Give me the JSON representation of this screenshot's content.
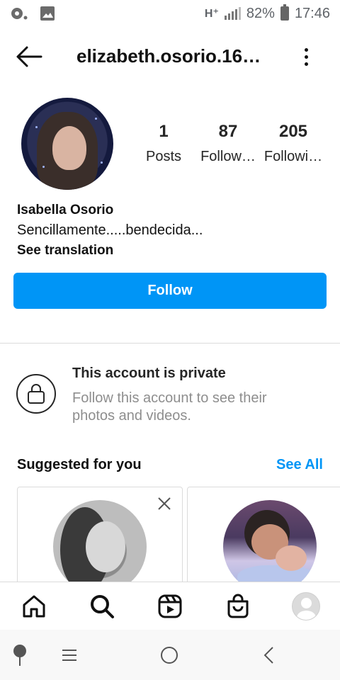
{
  "status_bar": {
    "network": "H⁺",
    "battery": "82%",
    "time": "17:46",
    "icons": [
      "media-dot-icon",
      "image-icon",
      "signal-icon",
      "battery-icon"
    ]
  },
  "header": {
    "username": "elizabeth.osorio.16…",
    "back_icon": "arrow-left-icon",
    "more_icon": "vertical-dots-icon"
  },
  "profile": {
    "stats": [
      {
        "value": "1",
        "label": "Posts"
      },
      {
        "value": "87",
        "label": "Follow…"
      },
      {
        "value": "205",
        "label": "Followi…"
      }
    ],
    "full_name": "Isabella Osorio",
    "bio": "Sencillamente.....bendecida...",
    "see_translation": "See translation",
    "follow_button": "Follow"
  },
  "private_notice": {
    "title": "This account is private",
    "subtitle": "Follow this account to see their photos and videos.",
    "icon": "lock-icon"
  },
  "suggested": {
    "title": "Suggested for you",
    "see_all": "See All"
  },
  "bottom_nav": {
    "items": [
      "home-icon",
      "search-icon",
      "reels-icon",
      "shop-icon",
      "profile-avatar"
    ]
  },
  "system_nav": {
    "items": [
      "pin-icon",
      "menu-icon",
      "home-circle-icon",
      "back-chevron-icon"
    ]
  },
  "colors": {
    "accent": "#0095f6",
    "text": "#262626",
    "secondary_text": "#8e8e8e",
    "divider": "#dbdbdb"
  }
}
